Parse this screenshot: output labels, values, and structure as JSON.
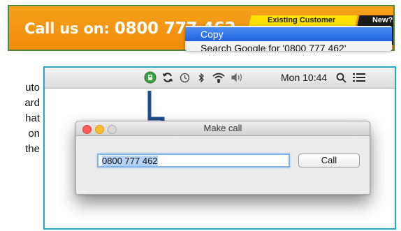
{
  "banner": {
    "call_label": "Call us on: ",
    "phone_partial": "0800 777 462",
    "existing_customer_label": "Existing Customer",
    "new_label": "New?",
    "new_label_2": "N",
    "bg_color": "#f39a12",
    "border_color": "#4f8a3c"
  },
  "context_menu": {
    "items": [
      "Copy",
      "Search Google for '0800 777 462'"
    ]
  },
  "side_text": [
    "uto",
    "ard",
    "hat",
    "on",
    "the"
  ],
  "menubar": {
    "clock": "Mon 10:44",
    "icons": [
      "phone-app-icon",
      "sync-icon",
      "time-machine-icon",
      "bluetooth-icon",
      "wifi-icon",
      "volume-icon",
      "spotlight-search-icon",
      "notification-list-icon"
    ]
  },
  "window": {
    "title": "Make call",
    "phone_value": "0800 777 462",
    "call_button_label": "Call"
  },
  "colors": {
    "frame_border": "#2ba6cb",
    "arrow": "#1f4f8f",
    "input_focus": "#7fb4ea"
  }
}
